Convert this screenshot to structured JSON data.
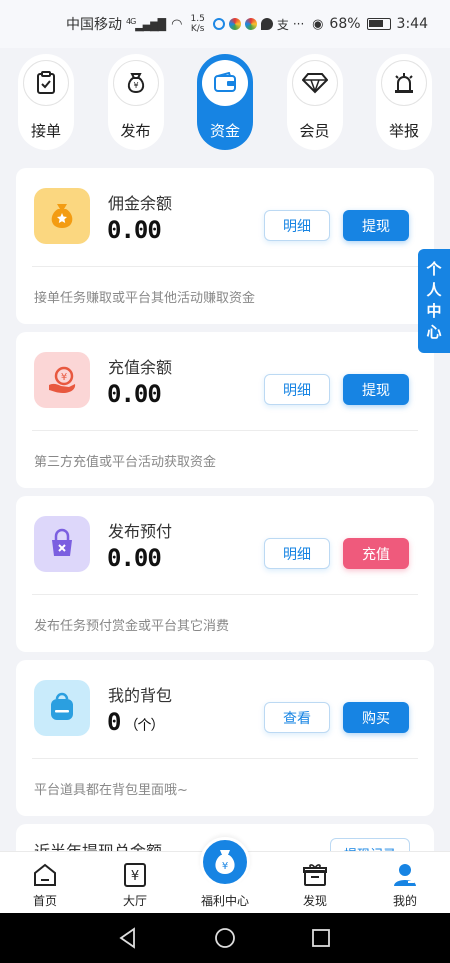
{
  "status_bar": {
    "carrier": "中国移动",
    "network": "4G",
    "speed_top": "1.5",
    "speed_bottom": "K/s",
    "battery": "68%",
    "time": "3:44"
  },
  "top_nav": [
    {
      "label": "接单",
      "icon": "clipboard-check-icon",
      "active": false
    },
    {
      "label": "发布",
      "icon": "money-bag-icon",
      "active": false
    },
    {
      "label": "资金",
      "icon": "wallet-icon",
      "active": true
    },
    {
      "label": "会员",
      "icon": "diamond-icon",
      "active": false
    },
    {
      "label": "举报",
      "icon": "alarm-light-icon",
      "active": false
    }
  ],
  "cards": [
    {
      "title": "佣金余额",
      "amount": "0.00",
      "btn1": "明细",
      "btn2": "提现",
      "desc": "接单任务赚取或平台其他活动赚取资金",
      "icon": "commission-bag-icon",
      "color": "#fbd780"
    },
    {
      "title": "充值余额",
      "amount": "0.00",
      "btn1": "明细",
      "btn2": "提现",
      "desc": "第三方充值或平台活动获取资金",
      "icon": "recharge-hand-icon",
      "color": "#fbd6d6"
    },
    {
      "title": "发布预付",
      "amount": "0.00",
      "btn1": "明细",
      "btn2": "充值",
      "desc": "发布任务预付赏金或平台其它消费",
      "icon": "lock-bag-icon",
      "color": "#ddd7fa"
    },
    {
      "title": "我的背包",
      "amount": "0",
      "unit": "（个）",
      "btn1": "查看",
      "btn2": "购买",
      "desc": "平台道具都在背包里面哦~",
      "icon": "backpack-icon",
      "color": "#c9ebfb"
    }
  ],
  "partial_card": {
    "title": "近半年提现总金额",
    "button": "提现记录"
  },
  "side_tab": [
    "个",
    "人",
    "中",
    "心"
  ],
  "tab_bar": [
    {
      "label": "首页",
      "icon": "home-icon"
    },
    {
      "label": "大厅",
      "icon": "hall-yen-icon"
    },
    {
      "label": "福利中心",
      "icon": "welfare-bag-icon"
    },
    {
      "label": "发现",
      "icon": "gift-box-icon"
    },
    {
      "label": "我的",
      "icon": "user-icon"
    }
  ],
  "colors": {
    "primary": "#1784e3",
    "pink": "#ef5a7c",
    "background": "#f2f3f7"
  }
}
